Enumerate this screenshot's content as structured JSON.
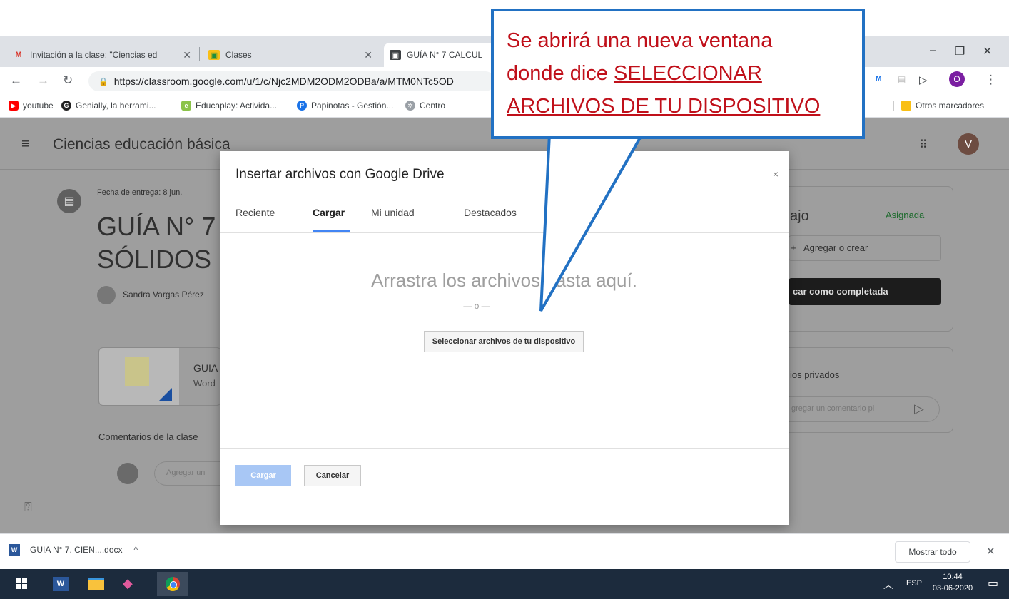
{
  "browser": {
    "tabs": [
      {
        "label": "Invitación a la clase: \"Ciencias ed",
        "icon": "gmail-icon"
      },
      {
        "label": "Clases",
        "icon": "classroom-icon"
      },
      {
        "label": "GUÍA N° 7 CALCUL",
        "icon": "classroom-icon"
      }
    ],
    "url": "https://classroom.google.com/u/1/c/Njc2MDM2ODM2ODBa/a/MTM0NTc5OD",
    "bookmarks": [
      "youtube",
      "Genially, la herrami...",
      "Educaplay: Activida...",
      "Papinotas - Gestión...",
      "Centro"
    ],
    "other_bookmarks": "Otros marcadores",
    "avatar_letter": "O"
  },
  "classroom": {
    "title": "Ciencias educación básica",
    "due": "Fecha de entrega: 8 jun.",
    "assignment_title_1": "GUÍA N° 7 C",
    "assignment_title_2": "SÓLIDOS R",
    "teacher": "Sandra Vargas Pérez",
    "attachment_name": "GUIA",
    "attachment_type": "Word",
    "class_comments": "Comentarios de la clase",
    "comment_placeholder": "Agregar un",
    "work_title": "ajo",
    "work_status": "Asignada",
    "add_or_create": "Agregar o crear",
    "mark_done": "car como completada",
    "private_comments": "ios privados",
    "private_placeholder": "gregar un comentario pi",
    "user_initial": "V"
  },
  "modal": {
    "title": "Insertar archivos con Google Drive",
    "close": "×",
    "tabs": [
      "Reciente",
      "Cargar",
      "Mi unidad",
      "Destacados"
    ],
    "active_tab": "Cargar",
    "drop_text": "Arrastra los archivos hasta aquí.",
    "or_text": "— o —",
    "select_button": "Seleccionar archivos de tu dispositivo",
    "upload_button": "Cargar",
    "cancel_button": "Cancelar"
  },
  "callout": {
    "line1": "Se abrirá una nueva ventana",
    "line2_prefix": "donde dice ",
    "line2_link": "SELECCIONAR",
    "line3_link": "ARCHIVOS DE TU DISPOSITIVO"
  },
  "downloads": {
    "file": "GUIA N° 7. CIEN....docx",
    "show_all": "Mostrar todo"
  },
  "taskbar": {
    "lang": "ESP",
    "time": "10:44",
    "date": "03-06-2020"
  },
  "colors": {
    "callout_border": "#2271c3",
    "callout_text": "#c0101a",
    "accent_blue": "#4285f4",
    "status_green": "#1e8e3e"
  }
}
